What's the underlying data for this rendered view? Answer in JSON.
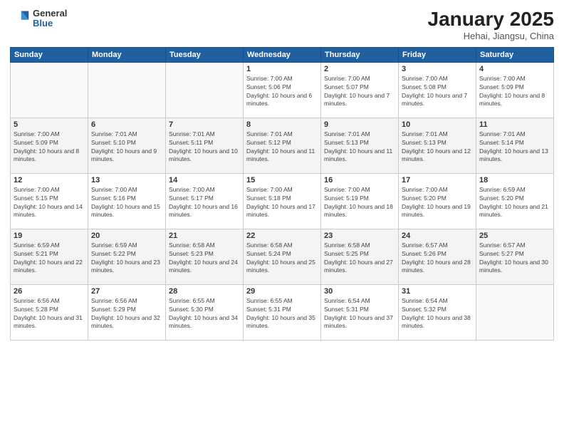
{
  "logo": {
    "general": "General",
    "blue": "Blue"
  },
  "header": {
    "month": "January 2025",
    "location": "Hehai, Jiangsu, China"
  },
  "weekdays": [
    "Sunday",
    "Monday",
    "Tuesday",
    "Wednesday",
    "Thursday",
    "Friday",
    "Saturday"
  ],
  "weeks": [
    [
      {
        "day": "",
        "sunrise": "",
        "sunset": "",
        "daylight": ""
      },
      {
        "day": "",
        "sunrise": "",
        "sunset": "",
        "daylight": ""
      },
      {
        "day": "",
        "sunrise": "",
        "sunset": "",
        "daylight": ""
      },
      {
        "day": "1",
        "sunrise": "Sunrise: 7:00 AM",
        "sunset": "Sunset: 5:06 PM",
        "daylight": "Daylight: 10 hours and 6 minutes."
      },
      {
        "day": "2",
        "sunrise": "Sunrise: 7:00 AM",
        "sunset": "Sunset: 5:07 PM",
        "daylight": "Daylight: 10 hours and 7 minutes."
      },
      {
        "day": "3",
        "sunrise": "Sunrise: 7:00 AM",
        "sunset": "Sunset: 5:08 PM",
        "daylight": "Daylight: 10 hours and 7 minutes."
      },
      {
        "day": "4",
        "sunrise": "Sunrise: 7:00 AM",
        "sunset": "Sunset: 5:09 PM",
        "daylight": "Daylight: 10 hours and 8 minutes."
      }
    ],
    [
      {
        "day": "5",
        "sunrise": "Sunrise: 7:00 AM",
        "sunset": "Sunset: 5:09 PM",
        "daylight": "Daylight: 10 hours and 8 minutes."
      },
      {
        "day": "6",
        "sunrise": "Sunrise: 7:01 AM",
        "sunset": "Sunset: 5:10 PM",
        "daylight": "Daylight: 10 hours and 9 minutes."
      },
      {
        "day": "7",
        "sunrise": "Sunrise: 7:01 AM",
        "sunset": "Sunset: 5:11 PM",
        "daylight": "Daylight: 10 hours and 10 minutes."
      },
      {
        "day": "8",
        "sunrise": "Sunrise: 7:01 AM",
        "sunset": "Sunset: 5:12 PM",
        "daylight": "Daylight: 10 hours and 11 minutes."
      },
      {
        "day": "9",
        "sunrise": "Sunrise: 7:01 AM",
        "sunset": "Sunset: 5:13 PM",
        "daylight": "Daylight: 10 hours and 11 minutes."
      },
      {
        "day": "10",
        "sunrise": "Sunrise: 7:01 AM",
        "sunset": "Sunset: 5:13 PM",
        "daylight": "Daylight: 10 hours and 12 minutes."
      },
      {
        "day": "11",
        "sunrise": "Sunrise: 7:01 AM",
        "sunset": "Sunset: 5:14 PM",
        "daylight": "Daylight: 10 hours and 13 minutes."
      }
    ],
    [
      {
        "day": "12",
        "sunrise": "Sunrise: 7:00 AM",
        "sunset": "Sunset: 5:15 PM",
        "daylight": "Daylight: 10 hours and 14 minutes."
      },
      {
        "day": "13",
        "sunrise": "Sunrise: 7:00 AM",
        "sunset": "Sunset: 5:16 PM",
        "daylight": "Daylight: 10 hours and 15 minutes."
      },
      {
        "day": "14",
        "sunrise": "Sunrise: 7:00 AM",
        "sunset": "Sunset: 5:17 PM",
        "daylight": "Daylight: 10 hours and 16 minutes."
      },
      {
        "day": "15",
        "sunrise": "Sunrise: 7:00 AM",
        "sunset": "Sunset: 5:18 PM",
        "daylight": "Daylight: 10 hours and 17 minutes."
      },
      {
        "day": "16",
        "sunrise": "Sunrise: 7:00 AM",
        "sunset": "Sunset: 5:19 PM",
        "daylight": "Daylight: 10 hours and 18 minutes."
      },
      {
        "day": "17",
        "sunrise": "Sunrise: 7:00 AM",
        "sunset": "Sunset: 5:20 PM",
        "daylight": "Daylight: 10 hours and 19 minutes."
      },
      {
        "day": "18",
        "sunrise": "Sunrise: 6:59 AM",
        "sunset": "Sunset: 5:20 PM",
        "daylight": "Daylight: 10 hours and 21 minutes."
      }
    ],
    [
      {
        "day": "19",
        "sunrise": "Sunrise: 6:59 AM",
        "sunset": "Sunset: 5:21 PM",
        "daylight": "Daylight: 10 hours and 22 minutes."
      },
      {
        "day": "20",
        "sunrise": "Sunrise: 6:59 AM",
        "sunset": "Sunset: 5:22 PM",
        "daylight": "Daylight: 10 hours and 23 minutes."
      },
      {
        "day": "21",
        "sunrise": "Sunrise: 6:58 AM",
        "sunset": "Sunset: 5:23 PM",
        "daylight": "Daylight: 10 hours and 24 minutes."
      },
      {
        "day": "22",
        "sunrise": "Sunrise: 6:58 AM",
        "sunset": "Sunset: 5:24 PM",
        "daylight": "Daylight: 10 hours and 25 minutes."
      },
      {
        "day": "23",
        "sunrise": "Sunrise: 6:58 AM",
        "sunset": "Sunset: 5:25 PM",
        "daylight": "Daylight: 10 hours and 27 minutes."
      },
      {
        "day": "24",
        "sunrise": "Sunrise: 6:57 AM",
        "sunset": "Sunset: 5:26 PM",
        "daylight": "Daylight: 10 hours and 28 minutes."
      },
      {
        "day": "25",
        "sunrise": "Sunrise: 6:57 AM",
        "sunset": "Sunset: 5:27 PM",
        "daylight": "Daylight: 10 hours and 30 minutes."
      }
    ],
    [
      {
        "day": "26",
        "sunrise": "Sunrise: 6:56 AM",
        "sunset": "Sunset: 5:28 PM",
        "daylight": "Daylight: 10 hours and 31 minutes."
      },
      {
        "day": "27",
        "sunrise": "Sunrise: 6:56 AM",
        "sunset": "Sunset: 5:29 PM",
        "daylight": "Daylight: 10 hours and 32 minutes."
      },
      {
        "day": "28",
        "sunrise": "Sunrise: 6:55 AM",
        "sunset": "Sunset: 5:30 PM",
        "daylight": "Daylight: 10 hours and 34 minutes."
      },
      {
        "day": "29",
        "sunrise": "Sunrise: 6:55 AM",
        "sunset": "Sunset: 5:31 PM",
        "daylight": "Daylight: 10 hours and 35 minutes."
      },
      {
        "day": "30",
        "sunrise": "Sunrise: 6:54 AM",
        "sunset": "Sunset: 5:31 PM",
        "daylight": "Daylight: 10 hours and 37 minutes."
      },
      {
        "day": "31",
        "sunrise": "Sunrise: 6:54 AM",
        "sunset": "Sunset: 5:32 PM",
        "daylight": "Daylight: 10 hours and 38 minutes."
      },
      {
        "day": "",
        "sunrise": "",
        "sunset": "",
        "daylight": ""
      }
    ]
  ]
}
